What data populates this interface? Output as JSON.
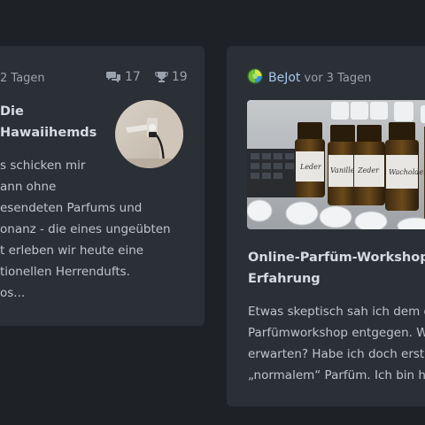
{
  "left_card": {
    "time": "2 Tagen",
    "comments": "17",
    "likes": "19",
    "title_lines": [
      "Die",
      "Hawaiihemds"
    ],
    "body_lines": [
      "s schicken mir",
      "ann ohne",
      "esendeten Parfums und",
      "onanz - die eines ungeübten",
      "t erleben wir heute eine",
      "tionellen Herrendufts.",
      "os..."
    ],
    "comment_icon": "comments-icon",
    "likes_icon": "trophy-icon"
  },
  "right_card": {
    "author": "BeJot",
    "time": "vor 3 Tagen",
    "avatar_icon": "user-avatar",
    "photo_labels": [
      "Leder",
      "Vanille",
      "Zeder",
      "Wacholder"
    ],
    "title_lines": [
      "Online-Parfüm-Workshop ..",
      "Erfahrung"
    ],
    "body_lines": [
      "Etwas skeptisch sah ich dem ge",
      "Parfümworkshop entgegen. W",
      "erwarten? Habe ich doch erst s",
      "„normalem“ Parfüm. Ich bin ha"
    ]
  },
  "colors": {
    "page_bg": "#1e2126",
    "card_bg": "#2b2f36",
    "author": "#a6c8ee"
  }
}
